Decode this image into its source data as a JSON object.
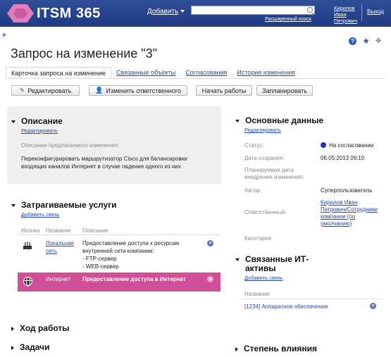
{
  "header": {
    "brand": "ITSM 365",
    "add_menu": "Добавить",
    "search_placeholder": "",
    "advanced_search": "Расширенный поиск",
    "user_name_line1": "Кирилов",
    "user_name_line2": "Иван",
    "user_name_line3": "Петрович",
    "logout": "Выход"
  },
  "page": {
    "collapse": "»",
    "title": "Запрос на изменение \"3\""
  },
  "tabs": [
    {
      "label": "Карточка запроса на изменение",
      "active": true
    },
    {
      "label": "Связанные объекты",
      "active": false
    },
    {
      "label": "Согласования",
      "active": false
    },
    {
      "label": "История изменения",
      "active": false
    }
  ],
  "toolbar": {
    "edit": "Редактировать",
    "change_responsible": "Изменить ответственного",
    "start_work": "Начать работы",
    "schedule": "Запланировать"
  },
  "description": {
    "title": "Описание",
    "edit_link": "Редактировать",
    "field_label": "Описание предлагаемого изменения:",
    "text_line1": "Переконфигурировать маршрутизатор Cisco для балансировки",
    "text_line2": "входящих каналов Интернет в случае падения одного из них"
  },
  "services": {
    "title": "Затрагиваемые услуги",
    "add_link": "Добавить связь",
    "columns": {
      "icon": "Иконка",
      "name": "Название",
      "description": "Описание"
    },
    "rows": [
      {
        "icon": "router-icon",
        "name_line1": "Локальная",
        "name_line2": "сеть",
        "desc_line1": "Предоставление доступа к ресурсам",
        "desc_line2": "внутренней сети компании:",
        "desc_line3": "- FTP-сервер",
        "desc_line4": "- WEB-сервер"
      },
      {
        "icon": "globe-icon",
        "name": "Интернет",
        "description": "Предоставление доступа в Интернет"
      }
    ]
  },
  "sections_collapsed": {
    "progress": "Ход работы",
    "tasks": "Задачи",
    "impact": "Степень влияния"
  },
  "main_data": {
    "title": "Основные данные",
    "edit_link": "Редактировать",
    "status_label": "Статус:",
    "status_value": "На согласовании",
    "created_label": "Дата создания:",
    "created_value": "06.05.2013 09:10",
    "planned_label_line1": "Планируемая дата",
    "planned_label_line2": "внедрения изменения:",
    "author_label": "Автор:",
    "author_value": "Суперпользователь",
    "responsible_label": "Ответственный:",
    "responsible_line1": "Кирилов Иван",
    "responsible_line2": "Петрович/Сотрудники",
    "responsible_line3": "компании (по",
    "responsible_line4": "умолчанию)",
    "category_label": "Категория:",
    "status_color": "#1d2fd6"
  },
  "assets": {
    "title_line1": "Связанные ИТ-",
    "title_line2": "активы",
    "add_link": "Добавить связь",
    "column_name": "Название",
    "item": "[1234] Аппаратное обеспечение"
  },
  "colors": {
    "header_bg": "#1e3a82",
    "accent_pink": "#d04f98",
    "link": "#1f4aa8"
  }
}
